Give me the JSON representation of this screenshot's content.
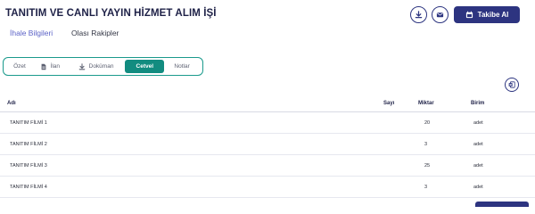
{
  "header": {
    "title": "TANITIM VE CANLI YAYIN HİZMET ALIM İŞİ",
    "follow_label": "Takibe Al"
  },
  "subnav": {
    "items": [
      {
        "label": "İhale Bilgileri",
        "active": true
      },
      {
        "label": "Olası Rakipler",
        "active": false
      }
    ]
  },
  "tabs": [
    {
      "label": "Özet",
      "icon": "none",
      "active": false
    },
    {
      "label": "İlan",
      "icon": "document-icon",
      "active": false
    },
    {
      "label": "Doküman",
      "icon": "download-icon",
      "active": false
    },
    {
      "label": "Cetvel",
      "icon": "none",
      "active": true
    },
    {
      "label": "Notlar",
      "icon": "none",
      "active": false
    }
  ],
  "table": {
    "columns": {
      "name": "Adı",
      "count": "Sayı",
      "quantity": "Miktar",
      "unit": "Birim"
    },
    "rows": [
      {
        "name": "TANITIM FİLMİ 1",
        "count": "",
        "quantity": "20",
        "unit": "adet"
      },
      {
        "name": "TANITIM FİLMİ 2",
        "count": "",
        "quantity": "3",
        "unit": "adet"
      },
      {
        "name": "TANITIM FİLMİ 3",
        "count": "",
        "quantity": "25",
        "unit": "adet"
      },
      {
        "name": "TANITIM FİLMİ 4",
        "count": "",
        "quantity": "3",
        "unit": "adet"
      }
    ]
  },
  "colors": {
    "primary": "#2d3480",
    "accent": "#128c80",
    "link": "#5c63c7"
  }
}
